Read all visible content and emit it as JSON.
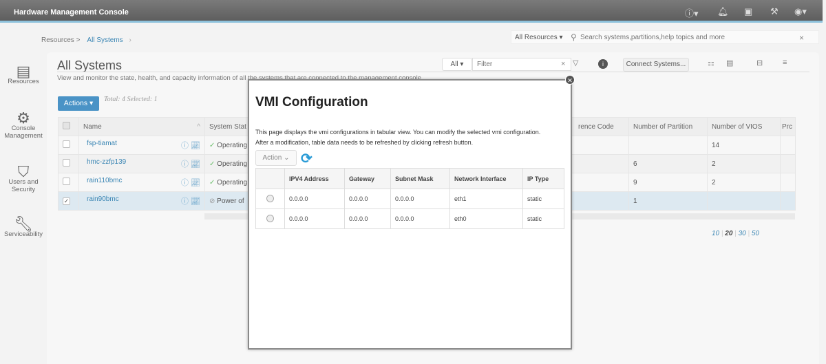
{
  "app": {
    "title": "Hardware Management Console"
  },
  "header_icons": [
    "help-icon",
    "bell-icon",
    "clipboard-icon",
    "wrench-icon",
    "user-icon"
  ],
  "sidebar": {
    "items": [
      {
        "label": "Resources",
        "icon": "server-icon"
      },
      {
        "label": "Console Management",
        "icon": "gear-list-icon"
      },
      {
        "label": "Users and Security",
        "icon": "shield-icon"
      },
      {
        "label": "Serviceability",
        "icon": "wrench-icon"
      }
    ]
  },
  "breadcrumb": {
    "parent": "Resources >",
    "current": "All Systems",
    "sep": "›"
  },
  "search": {
    "scope": "All Resources",
    "placeholder": "Search systems,partitions,help topics and more",
    "clear": "×"
  },
  "page": {
    "title": "All Systems",
    "description": "View and monitor the state, health, and capacity information of all the systems that are connected to the management console.",
    "actions": "Actions ▾",
    "total": "Total: 4 Selected: 1"
  },
  "toolbar": {
    "filter_scope": "All ▾",
    "filter_placeholder": "Filter",
    "connect": "Connect Systems..."
  },
  "systems": {
    "columns": [
      "Name",
      "System Stat",
      "rence Code",
      "Number of Partition",
      "Number of VIOS",
      "Prc"
    ],
    "rows": [
      {
        "name": "fsp-tiamat",
        "status": "Operating",
        "partitions": "",
        "vios": "14",
        "checked": false
      },
      {
        "name": "hmc-zzfp139",
        "status": "Operating",
        "partitions": "6",
        "vios": "2",
        "checked": false
      },
      {
        "name": "rain110bmc",
        "status": "Operating",
        "partitions": "9",
        "vios": "2",
        "checked": false
      },
      {
        "name": "rain90bmc",
        "status": "Power of",
        "partitions": "1",
        "vios": "",
        "checked": true
      }
    ]
  },
  "pagination": {
    "sizes": [
      "10",
      "20",
      "30",
      "50"
    ],
    "current": "20"
  },
  "modal": {
    "title": "VMI Configuration",
    "desc1": "This page displays the vmi configurations in tabular view. You can modify the selected vmi configuration.",
    "desc2": "After a modification, table data needs to be refreshed by clicking refresh button.",
    "action": "Action ⌄",
    "columns": [
      "IPV4 Address",
      "Gateway",
      "Subnet Mask",
      "Network Interface",
      "IP Type"
    ],
    "rows": [
      [
        "0.0.0.0",
        "0.0.0.0",
        "0.0.0.0",
        "eth1",
        "static"
      ],
      [
        "0.0.0.0",
        "0.0.0.0",
        "0.0.0.0",
        "eth0",
        "static"
      ]
    ]
  },
  "colors": {
    "accent": "#3b86b4",
    "header": "#5e5e5e",
    "refresh": "#2a9bd6"
  }
}
